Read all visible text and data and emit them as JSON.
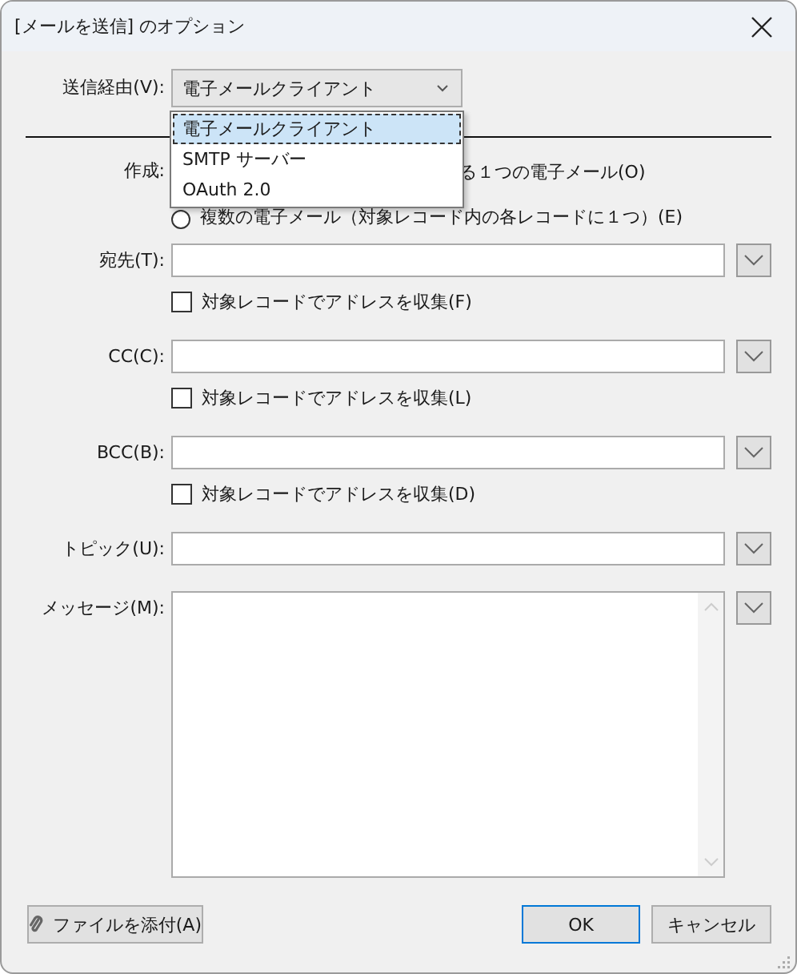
{
  "window": {
    "title": "[メールを送信] のオプション"
  },
  "send_via": {
    "label": "送信経由(V):",
    "value": "電子メールクライアント",
    "open": true,
    "options": [
      {
        "label": "電子メールクライアント",
        "selected": true
      },
      {
        "label": "SMTP サーバー",
        "selected": false
      },
      {
        "label": "OAuth 2.0",
        "selected": false
      }
    ]
  },
  "compose": {
    "label": "作成:",
    "options": [
      {
        "kind": "covered",
        "text": "る１つの電子メール(O)"
      },
      {
        "kind": "radio",
        "text": "複数の電子メール（対象レコード内の各レコードに１つ）(E)",
        "selected": false
      }
    ]
  },
  "fields": [
    {
      "kind": "line",
      "label": "宛先(T):",
      "checkbox": {
        "label": "対象レコードでアドレスを収集(F)",
        "checked": false
      }
    },
    {
      "kind": "line",
      "label": "CC(C):",
      "checkbox": {
        "label": "対象レコードでアドレスを収集(L)",
        "checked": false
      }
    },
    {
      "kind": "line",
      "label": "BCC(B):",
      "checkbox": {
        "label": "対象レコードでアドレスを収集(D)",
        "checked": false
      }
    },
    {
      "kind": "line",
      "label": "トピック(U):"
    },
    {
      "kind": "area",
      "label": "メッセージ(M):"
    }
  ],
  "buttons": [
    {
      "kind": "attach",
      "label": "ファイルを添付(A)"
    },
    {
      "kind": "default",
      "label": "OK"
    },
    {
      "kind": "normal",
      "label": "キャンセル"
    }
  ]
}
